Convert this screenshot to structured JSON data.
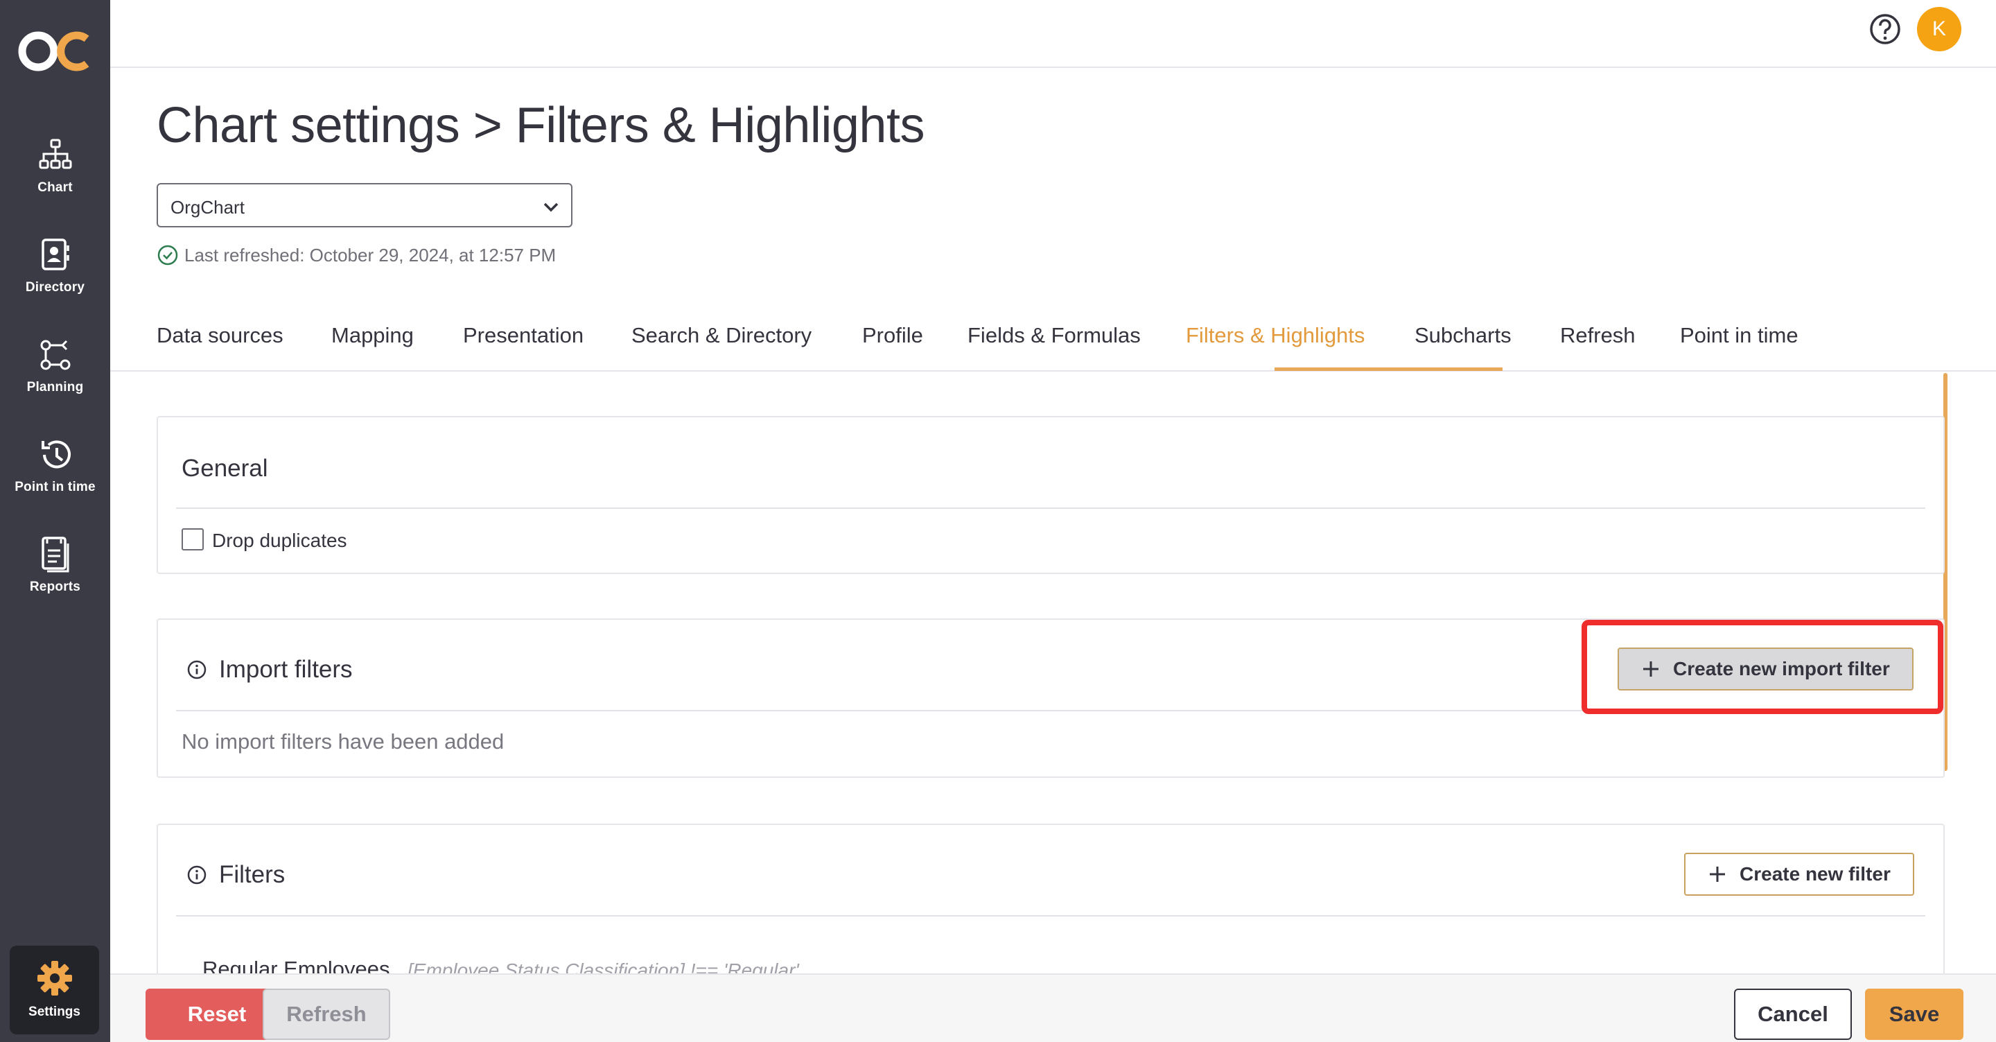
{
  "app": {
    "logo_text": "OC",
    "avatar_initial": "K"
  },
  "sidebar": {
    "items": [
      {
        "label": "Chart",
        "icon": "org-chart-icon"
      },
      {
        "label": "Directory",
        "icon": "directory-icon"
      },
      {
        "label": "Planning",
        "icon": "planning-icon"
      },
      {
        "label": "Point in time",
        "icon": "history-icon"
      },
      {
        "label": "Reports",
        "icon": "reports-icon"
      }
    ],
    "settings_label": "Settings"
  },
  "page": {
    "title": "Chart settings > Filters & Highlights",
    "chart_select_value": "OrgChart",
    "last_refreshed": "Last refreshed: October 29, 2024, at 12:57 PM"
  },
  "tabs": [
    {
      "label": "Data sources"
    },
    {
      "label": "Mapping"
    },
    {
      "label": "Presentation"
    },
    {
      "label": "Search & Directory"
    },
    {
      "label": "Profile"
    },
    {
      "label": "Fields & Formulas"
    },
    {
      "label": "Filters & Highlights",
      "active": true
    },
    {
      "label": "Subcharts"
    },
    {
      "label": "Refresh"
    },
    {
      "label": "Point in time"
    }
  ],
  "general": {
    "title": "General",
    "drop_duplicates_label": "Drop duplicates",
    "drop_duplicates_checked": false
  },
  "import_filters": {
    "title": "Import filters",
    "create_button": "Create new import filter",
    "empty_text": "No import filters have been added"
  },
  "filters": {
    "title": "Filters",
    "create_button": "Create new filter",
    "rows": [
      {
        "name": "Regular Employees",
        "expression": "[Employee Status Classification] !== 'Regular'"
      }
    ]
  },
  "footer": {
    "reset": "Reset",
    "refresh": "Refresh",
    "cancel": "Cancel",
    "save": "Save"
  },
  "colors": {
    "sidebar_bg": "#3b3b45",
    "accent": "#e39a3c",
    "avatar": "#f5a213",
    "reset": "#e35d5d",
    "save": "#f0a64a",
    "highlight_box": "#ef2d2d"
  }
}
